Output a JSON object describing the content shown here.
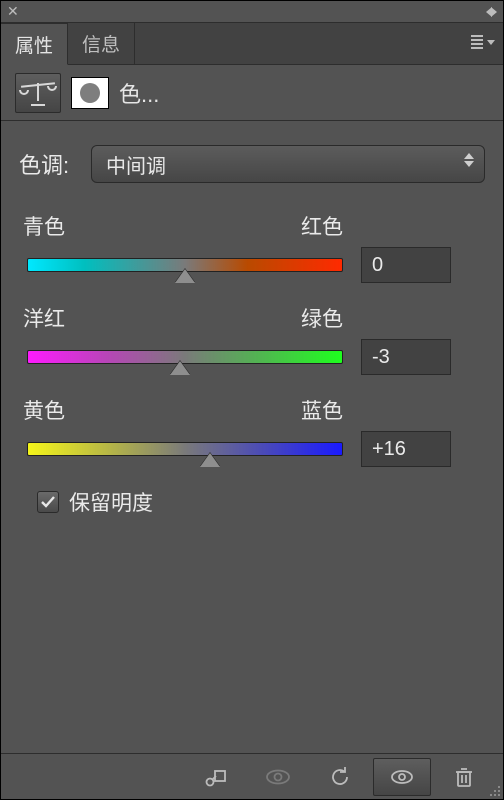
{
  "tabs": {
    "properties": "属性",
    "info": "信息"
  },
  "adjustment_title": "色...",
  "tone": {
    "label": "色调:",
    "selected": "中间调"
  },
  "sliders": {
    "cr": {
      "left": "青色",
      "right": "红色",
      "value": "0",
      "pos_pct": 50
    },
    "mg": {
      "left": "洋红",
      "right": "绿色",
      "value": "-3",
      "pos_pct": 48.5
    },
    "yb": {
      "left": "黄色",
      "right": "蓝色",
      "value": "+16",
      "pos_pct": 58
    }
  },
  "preserve_luminosity": "保留明度"
}
